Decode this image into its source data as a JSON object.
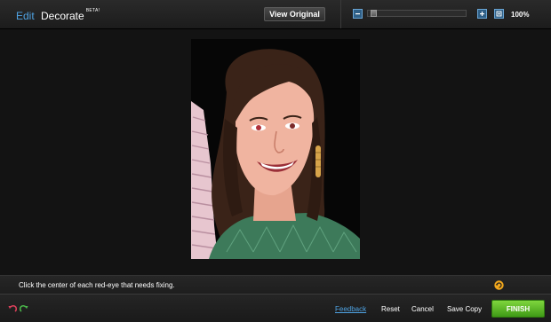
{
  "header": {
    "tabs": [
      {
        "label": "Edit",
        "active": true
      },
      {
        "label": "Decorate",
        "badge": "BETA!"
      }
    ],
    "view_original_label": "View Original",
    "zoom": {
      "level_label": "100%",
      "slider_value": 0.03,
      "minus_icon": "zoom-out-icon",
      "plus_icon": "zoom-in-icon",
      "fit_icon": "fit-to-screen-icon"
    }
  },
  "status": {
    "hint": "Click the center of each red-eye that needs fixing.",
    "undo_icon": "red-eye-undo-icon"
  },
  "footer": {
    "undo_icon": "undo-icon",
    "redo_icon": "redo-icon",
    "feedback_label": "Feedback",
    "reset_label": "Reset",
    "cancel_label": "Cancel",
    "save_copy_label": "Save Copy",
    "finish_label": "FINISH"
  },
  "colors": {
    "accent_blue": "#4fa3e3",
    "finish_green": "#5bbd26",
    "background": "#121212"
  }
}
